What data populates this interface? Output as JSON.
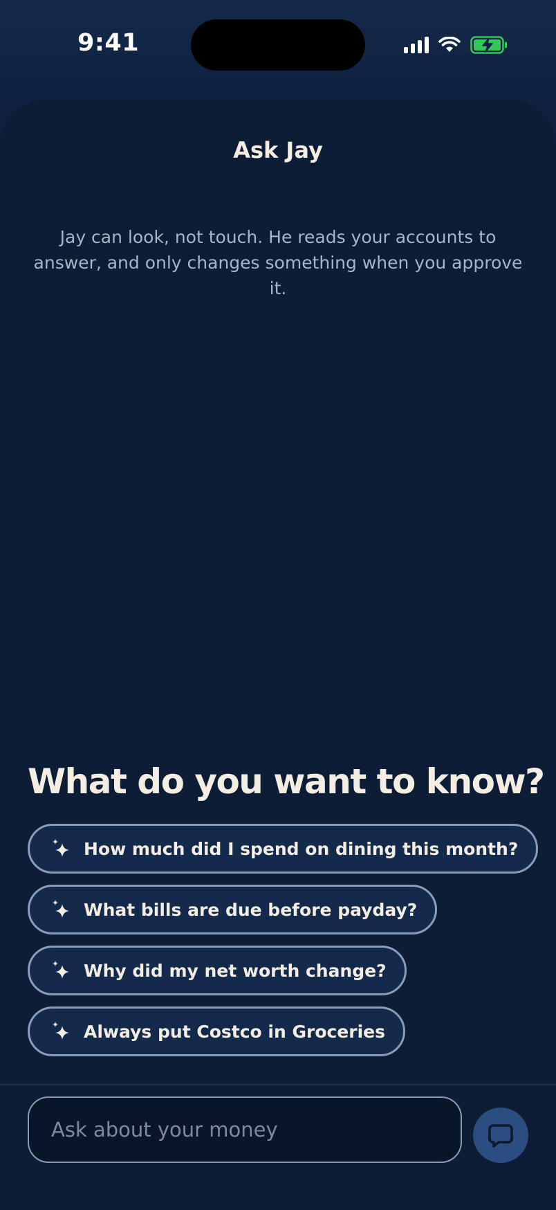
{
  "status_bar": {
    "time": "9:41"
  },
  "header": {
    "title": "Ask Jay"
  },
  "intro": {
    "text": "Jay can look, not touch. He reads your accounts to answer, and only changes something when you approve it."
  },
  "prompt": {
    "heading": "What do you want to know?"
  },
  "suggestions": [
    {
      "label": "How much did I spend on dining this month?",
      "icon": "sparkle-icon"
    },
    {
      "label": "What bills are due before payday?",
      "icon": "sparkle-icon"
    },
    {
      "label": "Why did my net worth change?",
      "icon": "sparkle-icon"
    },
    {
      "label": "Always put Costco in Groceries",
      "icon": "sparkle-icon"
    }
  ],
  "composer": {
    "placeholder": "Ask about your money",
    "send_icon": "chat-bubble-icon"
  },
  "colors": {
    "background": "#0d1b33",
    "chip_border": "#8a9cb8",
    "text": "#f4ede2",
    "send_button": "#2c4d7f",
    "battery": "#34c759"
  }
}
